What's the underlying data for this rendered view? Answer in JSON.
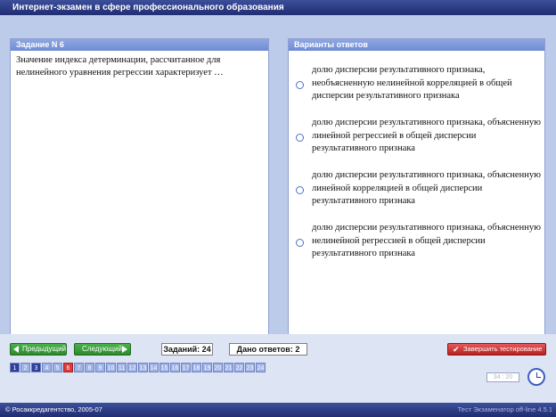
{
  "window": {
    "title": "Интернет-экзамен в сфере профессионального образования"
  },
  "question": {
    "header": "Задание N 6",
    "text": "Значение индекса детерминации, рассчитанное для нелинейного уравнения регрессии характеризует …"
  },
  "answers": {
    "header": "Варианты ответов",
    "options": [
      "долю дисперсии результативного признака, необъясненную нелинейной корреляцией в общей дисперсии результативного признака",
      "долю дисперсии результативного признака, объясненную линейной регрессией в общей дисперсии результативного признака",
      "долю дисперсии результативного признака, объясненную линейной корреляцией в общей дисперсии результативного признака",
      "долю дисперсии результативного признака, объясненную нелинейной регрессией в общей дисперсии результативного признака"
    ]
  },
  "nav": {
    "prev": "Предыдущий",
    "next": "Следующий"
  },
  "counters": {
    "tasks": "Заданий: 24",
    "answered": "Дано ответов: 2"
  },
  "finish_button": "Завершить тестирование",
  "pages": {
    "labels": [
      "1",
      "2",
      "3",
      "4",
      "5",
      "6",
      "7",
      "8",
      "9",
      "10",
      "11",
      "12",
      "13",
      "14",
      "15",
      "16",
      "17",
      "18",
      "19",
      "20",
      "21",
      "22",
      "23",
      "24"
    ],
    "answered": [
      1,
      3
    ],
    "current": 6
  },
  "timer": "34 : 20",
  "status": {
    "left": "© Росаккредагентство, 2005-07",
    "right": "Тест Экзаменатор off-line 4.5.1"
  },
  "colors": {
    "titlebar": "#1f2d72",
    "panel_header": "#7f97da",
    "answered_page": "#2d3f99",
    "current_page": "#d93a3a",
    "nav_button": "#2d8a2d",
    "finish_button": "#b92020"
  }
}
